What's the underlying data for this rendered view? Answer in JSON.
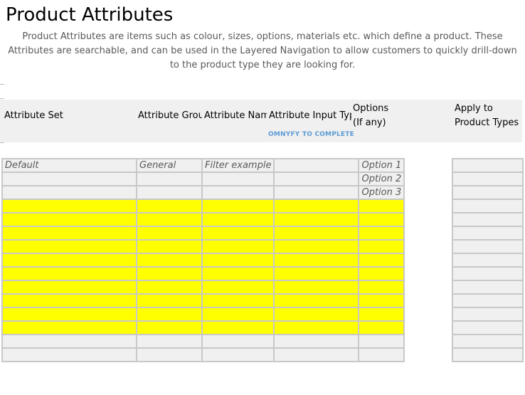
{
  "page": {
    "title": "Product Attributes",
    "description": "Product Attributes are items such as colour, sizes, options, materials etc. which define a product. These Attributes are searchable, and can be used in the Layered Navigation to allow customers to quickly drill-down to the product type they are looking for."
  },
  "headers": {
    "attribute_set": "Attribute Set",
    "attribute_group": "Attribute Grou",
    "attribute_name": "Attribute Nam",
    "attribute_input_type": "Attribute Input Typ",
    "options_line1": "Options",
    "options_line2": "(If any)",
    "apply_line1": "Apply to",
    "apply_line2": "Product Types"
  },
  "note": "OMNYFY TO COMPLETE",
  "rows": [
    {
      "set": "Default",
      "group": "General",
      "name": "Filter example",
      "input_type": "",
      "option": "Option 1",
      "highlight": false
    },
    {
      "set": "",
      "group": "",
      "name": "",
      "input_type": "",
      "option": "Option 2",
      "highlight": false
    },
    {
      "set": "",
      "group": "",
      "name": "",
      "input_type": "",
      "option": "Option 3",
      "highlight": false
    },
    {
      "set": "",
      "group": "",
      "name": "",
      "input_type": "",
      "option": "",
      "highlight": true
    },
    {
      "set": "",
      "group": "",
      "name": "",
      "input_type": "",
      "option": "",
      "highlight": true
    },
    {
      "set": "",
      "group": "",
      "name": "",
      "input_type": "",
      "option": "",
      "highlight": true
    },
    {
      "set": "",
      "group": "",
      "name": "",
      "input_type": "",
      "option": "",
      "highlight": true
    },
    {
      "set": "",
      "group": "",
      "name": "",
      "input_type": "",
      "option": "",
      "highlight": true
    },
    {
      "set": "",
      "group": "",
      "name": "",
      "input_type": "",
      "option": "",
      "highlight": true
    },
    {
      "set": "",
      "group": "",
      "name": "",
      "input_type": "",
      "option": "",
      "highlight": true
    },
    {
      "set": "",
      "group": "",
      "name": "",
      "input_type": "",
      "option": "",
      "highlight": true
    },
    {
      "set": "",
      "group": "",
      "name": "",
      "input_type": "",
      "option": "",
      "highlight": true
    },
    {
      "set": "",
      "group": "",
      "name": "",
      "input_type": "",
      "option": "",
      "highlight": true
    },
    {
      "set": "",
      "group": "",
      "name": "",
      "input_type": "",
      "option": "",
      "highlight": false
    },
    {
      "set": "",
      "group": "",
      "name": "",
      "input_type": "",
      "option": "",
      "highlight": false
    }
  ],
  "colors": {
    "highlight": "#ffff00",
    "cell": "#f0f0f0",
    "border": "#c8c8c8",
    "note": "#5b9bd5"
  }
}
